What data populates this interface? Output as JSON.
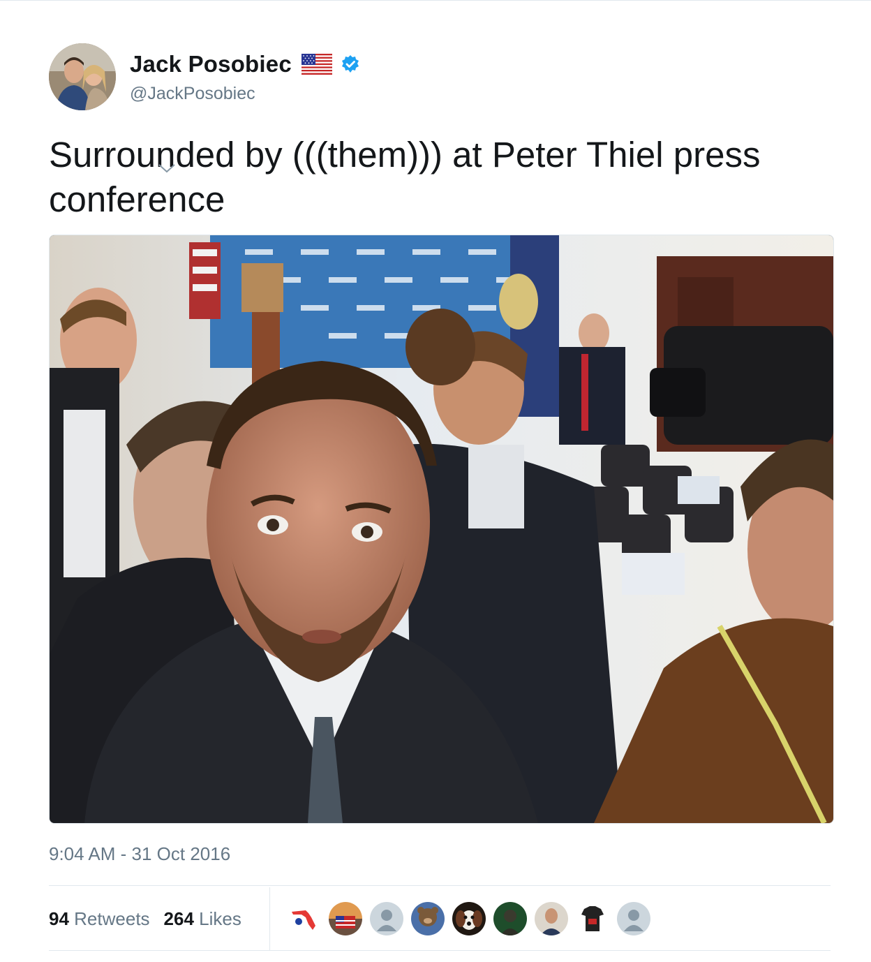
{
  "tweet": {
    "author": {
      "name": "Jack Posobiec",
      "handle": "@JackPosobiec",
      "verified": true,
      "name_icons": [
        "us-flag-icon",
        "verified-badge-icon"
      ]
    },
    "text": "Surrounded by (((them))) at Peter Thiel press conference",
    "timestamp": "9:04 AM - 31 Oct 2016",
    "media": {
      "type": "photo",
      "alt": "selfie"
    },
    "stats": {
      "retweets_count": "94",
      "retweets_label": "Retweets",
      "likes_count": "264",
      "likes_label": "Likes"
    },
    "likers": [
      {
        "icon": "florida-map-avatar",
        "color": "#e53935"
      },
      {
        "icon": "sunset-flag-avatar",
        "color": "#c27a3a"
      },
      {
        "icon": "default-user-avatar",
        "color": "#ccd6dd"
      },
      {
        "icon": "bear-avatar",
        "color": "#7a5a3a"
      },
      {
        "icon": "dog-avatar",
        "color": "#3a2a22"
      },
      {
        "icon": "person-green-avatar",
        "color": "#1f4a2a"
      },
      {
        "icon": "man-portrait-avatar",
        "color": "#b08a6a"
      },
      {
        "icon": "jersey-avatar",
        "color": "#222222"
      },
      {
        "icon": "default-user-avatar",
        "color": "#ccd6dd"
      }
    ]
  },
  "colors": {
    "text_primary": "#14171a",
    "text_secondary": "#657786",
    "verified_blue": "#1da1f2",
    "divider": "#e1e8ed"
  }
}
